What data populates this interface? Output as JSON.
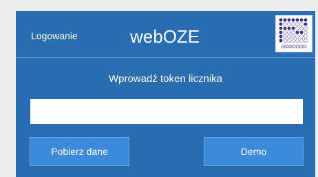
{
  "header": {
    "login_label": "Logowanie",
    "app_title": "webOZE",
    "logo_caption": "OOOOOOO"
  },
  "main": {
    "prompt": "Wprowadź token licznika",
    "token_input": {
      "value": "",
      "placeholder": ""
    },
    "fetch_button_label": "Pobierz dane",
    "demo_button_label": "Demo"
  },
  "colors": {
    "panel": "#2a6db0",
    "button": "#3d8ad9",
    "logo_dot": "#3b2a8c"
  }
}
